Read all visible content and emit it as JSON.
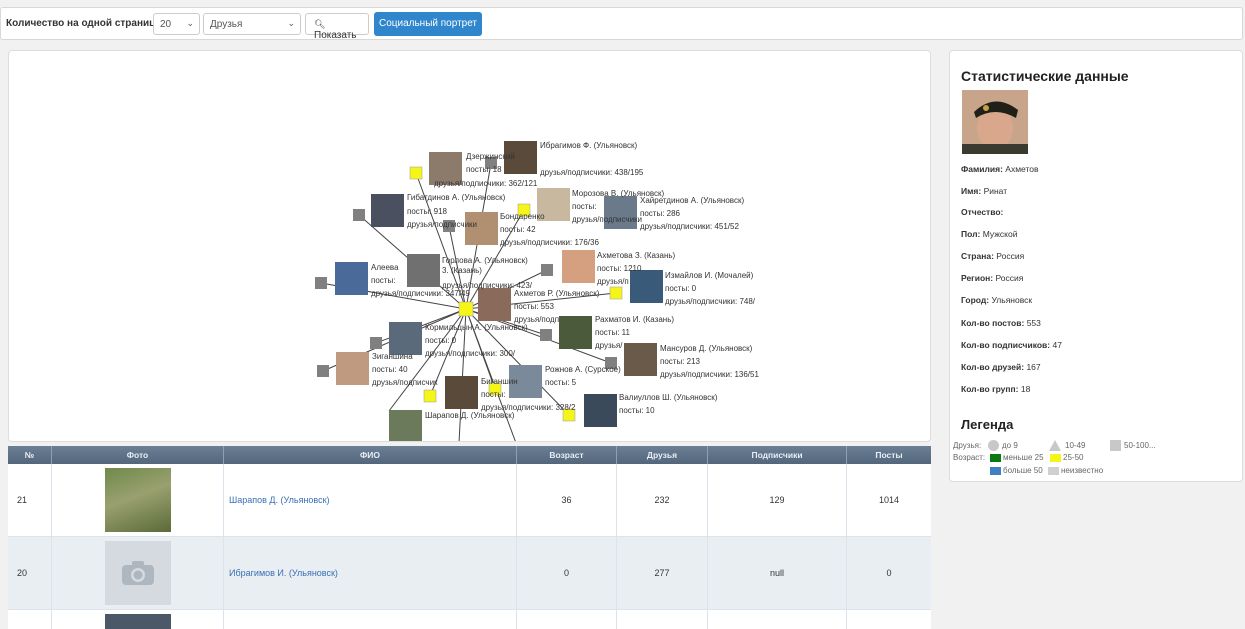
{
  "toolbar": {
    "per_page_label": "Количество на одной странице:",
    "per_page_value": "20",
    "filter_value": "Друзья",
    "show_button": "Показать",
    "portrait_button": "Социальный портрет"
  },
  "graph": {
    "nodes": [
      {
        "name": "Ибрагимов Ф. (Ульяновск)",
        "lines": [
          "друзья/подписчики: 438/195"
        ]
      },
      {
        "name": "Дзержинский",
        "lines": [
          "посты: 18",
          "друзья/подписчики: 362/121"
        ]
      },
      {
        "name": "Гибатдинов А. (Ульяновск)",
        "lines": [
          "посты: 918",
          "друзья/подписчики"
        ]
      },
      {
        "name": "Бондаренко",
        "lines": [
          "посты: 42",
          "друзья/подписчики: 176/36"
        ]
      },
      {
        "name": "Морозова В. (Ульяновск)",
        "lines": [
          "посты:",
          "друзья/подписчики"
        ]
      },
      {
        "name": "Хайретдинов А. (Ульяновск)",
        "lines": [
          "посты: 286",
          "друзья/подписчики: 451/52"
        ]
      },
      {
        "name": "Ахметова З. (Казань)",
        "lines": [
          "посты: 1210",
          "друзья/п"
        ]
      },
      {
        "name": "Горлова А. (Ульяновск)",
        "lines": [
          "3. (Казань)",
          "друзья/подписчики: 423/"
        ]
      },
      {
        "name": "Алеева",
        "lines": [
          "посты:",
          "друзья/подписчики: 347/49"
        ]
      },
      {
        "name": "Измайлов И. (Мочалей)",
        "lines": [
          "посты: 0",
          "друзья/подписчики: 748/"
        ]
      },
      {
        "name": "Ахметов Р. (Ульяновск)",
        "lines": [
          "посты: 553",
          "друзья/подп"
        ]
      },
      {
        "name": "Рахматов И. (Казань)",
        "lines": [
          "посты: 11",
          "друзья/"
        ]
      },
      {
        "name": "Кормильцын А. (Ульяновск)",
        "lines": [
          "посты: 0",
          "друзья/подписчики: 300/"
        ]
      },
      {
        "name": "Зиганшина",
        "lines": [
          "посты: 40",
          "друзья/подписчик"
        ]
      },
      {
        "name": "Мансуров Д. (Ульяновск)",
        "lines": [
          "посты: 213",
          "друзья/подписчики: 136/51"
        ]
      },
      {
        "name": "Рожнов А. (Сурское)",
        "lines": [
          "посты: 5",
          "друзья/подписчики: 328/2"
        ]
      },
      {
        "name": "Биганшин",
        "lines": [
          "посты:"
        ]
      },
      {
        "name": "Валиуллов Ш. (Ульяновск)",
        "lines": [
          "посты: 10"
        ]
      },
      {
        "name": "Шарапов Д. (Ульяновск)",
        "lines": []
      }
    ]
  },
  "stats": {
    "title": "Статистические данные",
    "rows": [
      {
        "label": "Фамилия:",
        "value": "Ахметов"
      },
      {
        "label": "Имя:",
        "value": "Ринат"
      },
      {
        "label": "Отчество:",
        "value": ""
      },
      {
        "label": "Пол:",
        "value": "Мужской"
      },
      {
        "label": "Страна:",
        "value": "Россия"
      },
      {
        "label": "Регион:",
        "value": "Россия"
      },
      {
        "label": "Город:",
        "value": "Ульяновск"
      },
      {
        "label": "Кол-во постов:",
        "value": "553"
      },
      {
        "label": "Кол-во подписчиков:",
        "value": "47"
      },
      {
        "label": "Кол-во друзей:",
        "value": "167"
      },
      {
        "label": "Кол-во групп:",
        "value": "18"
      }
    ],
    "legend_title": "Легенда",
    "legend": {
      "friends_label": "Друзья:",
      "friends_items": [
        "до 9",
        "10-49",
        "50-100..."
      ],
      "age_label": "Возраст:",
      "age_items": [
        "меньше 25",
        "25-50",
        "больше 50",
        "неизвестно"
      ],
      "age_colors": [
        "#0a7a12",
        "#f5f51a",
        "#3f7fc4",
        "#d0d0d0"
      ]
    }
  },
  "table": {
    "headers": [
      "№",
      "Фото",
      "ФИО",
      "Возраст",
      "Друзья",
      "Подписчики",
      "Посты"
    ],
    "rows": [
      {
        "num": "21",
        "name": "Шарапов Д. (Ульяновск)",
        "age": "36",
        "friends": "232",
        "followers": "129",
        "posts": "1014"
      },
      {
        "num": "20",
        "name": "Ибрагимов И. (Ульяновск)",
        "age": "0",
        "friends": "277",
        "followers": "null",
        "posts": "0"
      }
    ]
  }
}
